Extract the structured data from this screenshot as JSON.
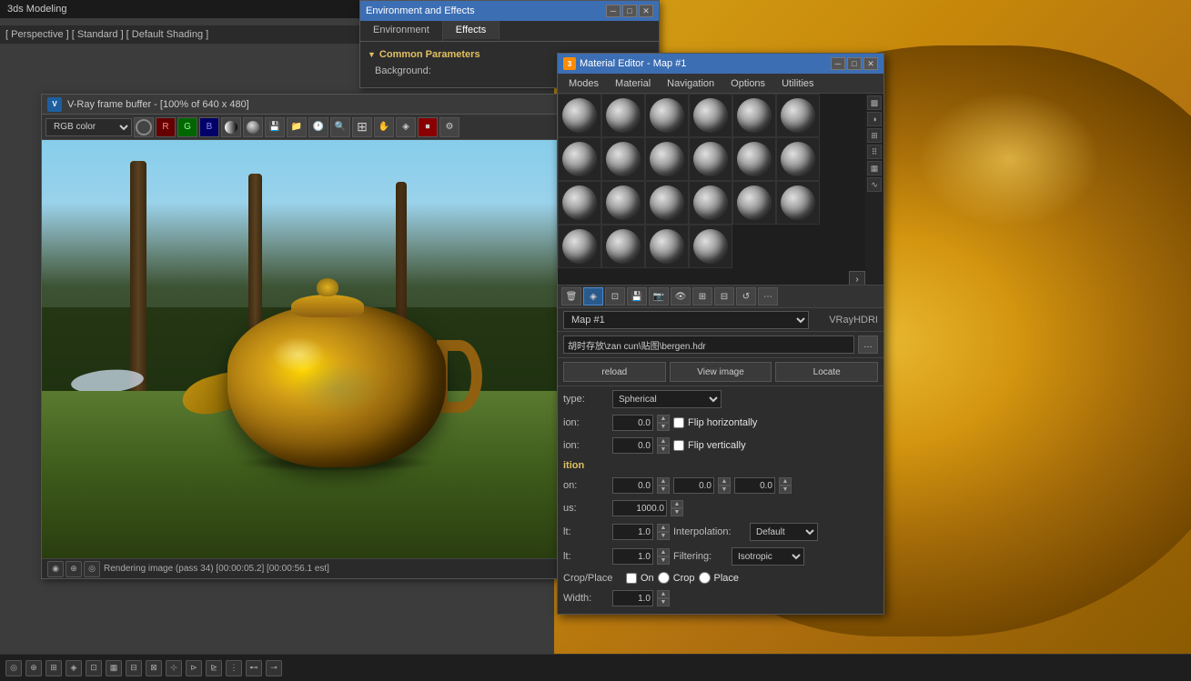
{
  "app": {
    "title": "3ds Modeling",
    "viewport_label": "[ Perspective ] [ Standard ] [ Default Shading ]"
  },
  "env_effects": {
    "title": "Environment and Effects",
    "tabs": [
      "Environment",
      "Effects"
    ],
    "active_tab": "Effects",
    "section_title": "Common Parameters",
    "background_label": "Background:"
  },
  "vray_fb": {
    "title": "V-Ray frame buffer - [100% of 640 x 480]",
    "color_mode": "RGB color",
    "status_text": "Rendering image (pass 34) [00:00:05.2] [00:00:56.1 est]",
    "icon_label": "V"
  },
  "mat_editor": {
    "title": "Material Editor - Map #1",
    "icon_label": "3",
    "menu_items": [
      "Modes",
      "Material",
      "Navigation",
      "Options",
      "Utilities"
    ],
    "map_name": "Map #1",
    "map_type": "VRayHDRI",
    "file_path": "胡时存放\\zan cun\\贴图\\bergen.hdr",
    "buttons": {
      "reload": "reload",
      "view_image": "View image",
      "locate": "Locate"
    },
    "params": {
      "type_label": "type:",
      "type_value": "Spherical",
      "horiz_rot_label": "ion:",
      "horiz_rot_value": "0.0",
      "vert_rot_label": "ion:",
      "vert_rot_value": "0.0",
      "flip_h_label": "Flip horizontally",
      "flip_v_label": "Flip vertically",
      "section_label": "ition",
      "pos_label": "on:",
      "pos_x": "0.0",
      "pos_y": "0.0",
      "pos_z": "0.0",
      "radius_label": "us:",
      "radius_value": "1000.0",
      "default1_label": "lt:",
      "default1_value": "1.0",
      "interp_label": "Interpolation:",
      "interp_value": "Default",
      "default2_label": "lt:",
      "default2_value": "1.0",
      "filter_label": "Filtering:",
      "filter_value": "Isotropic",
      "crop_place_label": "Crop/Place",
      "on_label": "On",
      "crop_label": "Crop",
      "place_label": "Place",
      "width_label": "Width:",
      "width_value": "1.0"
    }
  },
  "toolbar": {
    "color_channel": "RGB color"
  }
}
